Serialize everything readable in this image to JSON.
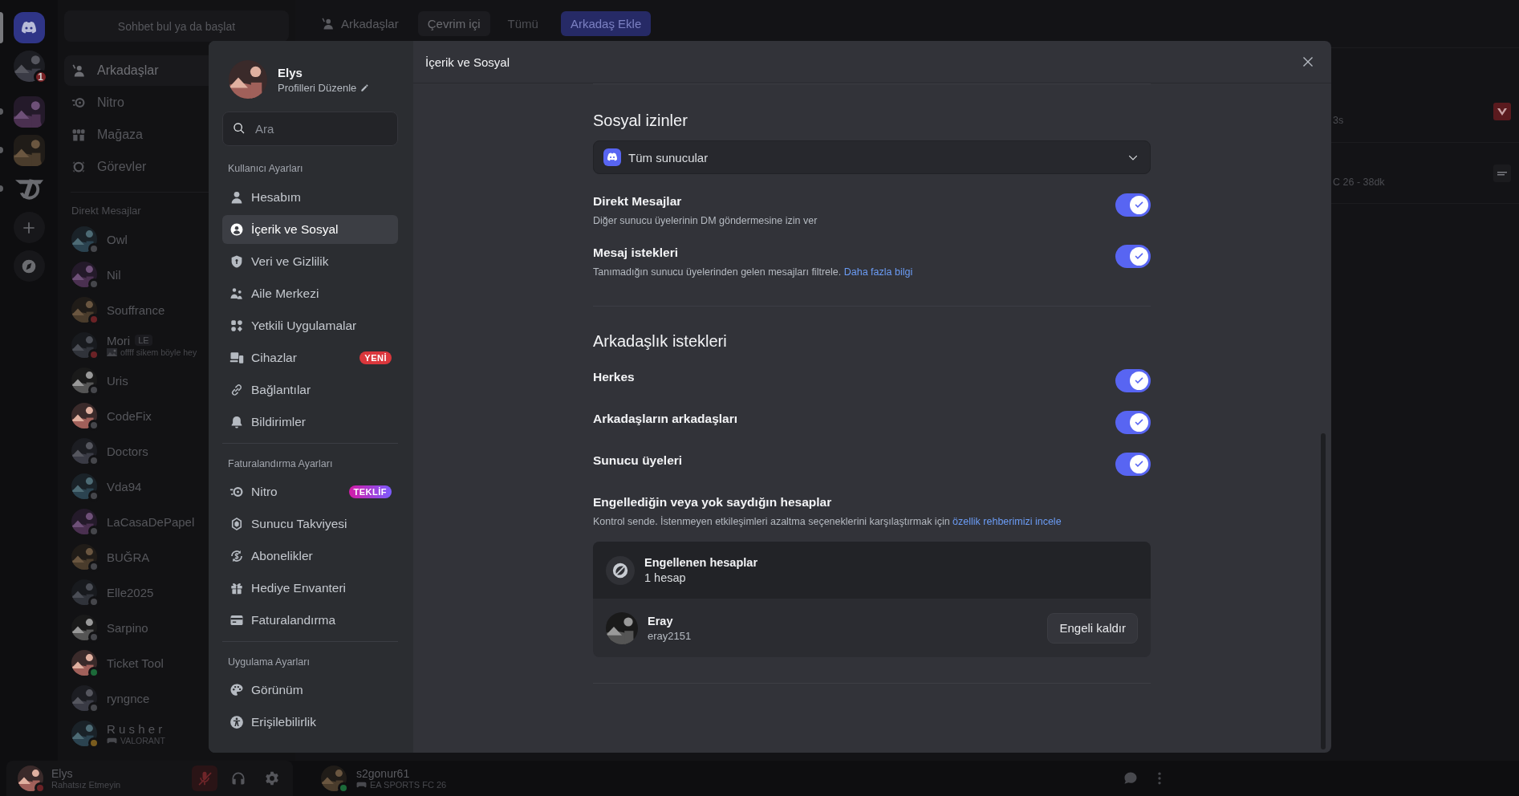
{
  "rail": {
    "items": [
      {
        "kind": "home",
        "selected": true,
        "unread": false
      },
      {
        "kind": "dm",
        "badge": "1",
        "selected": false,
        "unread": false
      },
      {
        "kind": "server",
        "selected": false,
        "unread": true
      },
      {
        "kind": "server",
        "selected": false,
        "unread": true
      },
      {
        "kind": "logo",
        "selected": false,
        "unread": true
      },
      {
        "kind": "add",
        "selected": false,
        "unread": false
      },
      {
        "kind": "discover",
        "selected": false,
        "unread": false
      }
    ]
  },
  "dm_sidebar": {
    "search": {
      "placeholder": "Sohbet bul ya da başlat"
    },
    "nav": [
      {
        "label": "Arkadaşlar",
        "kind": "friends",
        "selected": true
      },
      {
        "label": "Nitro",
        "kind": "nitro",
        "selected": false
      },
      {
        "label": "Mağaza",
        "kind": "shop",
        "selected": false
      },
      {
        "label": "Görevler",
        "kind": "quests",
        "selected": false
      }
    ],
    "heading": "Direkt Mesajlar",
    "conversations": [
      {
        "name": "Owl",
        "kind": "plain",
        "color": "#45464b"
      },
      {
        "name": "Nil",
        "kind": "plain",
        "color": "#45464b"
      },
      {
        "name": "Souffrance",
        "kind": "plain",
        "color": "#6b2226"
      },
      {
        "name": "Mori",
        "kind": "custom",
        "color": "#6b2226",
        "tag": "LE",
        "subtitle": "offff sikem böyle hey"
      },
      {
        "name": "Uris",
        "kind": "plain",
        "color": "#45464b"
      },
      {
        "name": "CodeFix",
        "kind": "plain",
        "color": "#45464b"
      },
      {
        "name": "Doctors",
        "kind": "plain",
        "color": "#45464b"
      },
      {
        "name": "Vda94",
        "kind": "plain",
        "color": "#45464b"
      },
      {
        "name": "LaCasaDePapel",
        "kind": "plain",
        "color": "#45464b"
      },
      {
        "name": "BUĞRA",
        "kind": "plain",
        "color": "#45464b"
      },
      {
        "name": "Elle2025",
        "kind": "plain",
        "color": "#45464b"
      },
      {
        "name": "Sarpino",
        "kind": "plain",
        "color": "#45464b"
      },
      {
        "name": "Ticket Tool",
        "kind": "plain",
        "color": "#1c6a39"
      },
      {
        "name": "ryngnce",
        "kind": "plain",
        "color": "#45464b"
      },
      {
        "name": "R u s h e r",
        "kind": "playing",
        "color": "#7a5c1e",
        "subtitle": "VALORANT"
      }
    ]
  },
  "friends_header": {
    "title": "Arkadaşlar",
    "tabs": [
      {
        "label": "Çevrim içi",
        "selected": true
      },
      {
        "label": "Tümü",
        "selected": false
      }
    ],
    "add_friend": "Arkadaş Ekle"
  },
  "activity_peek": [
    {
      "text": "3s"
    },
    {
      "text": "C 26 - 38dk"
    }
  ],
  "user_panel": {
    "name": "Elys",
    "status": "Rahatsız Etmeyin",
    "mic_muted": true
  },
  "now_playing": {
    "name": "s2gonur61",
    "game": "EA SPORTS FC 26"
  },
  "settings_modal": {
    "title": "İçerik ve Sosyal",
    "profile": {
      "name": "Elys",
      "edit_label": "Profilleri Düzenle"
    },
    "search": {
      "placeholder": "Ara"
    },
    "sections": [
      {
        "heading": "Kullanıcı Ayarları",
        "items": [
          {
            "label": "Hesabım",
            "kind": "account",
            "selected": false
          },
          {
            "label": "İçerik ve Sosyal",
            "kind": "content",
            "selected": true
          },
          {
            "label": "Veri ve Gizlilik",
            "kind": "privacy",
            "selected": false
          },
          {
            "label": "Aile Merkezi",
            "kind": "family",
            "selected": false
          },
          {
            "label": "Yetkili Uygulamalar",
            "kind": "apps",
            "selected": false
          },
          {
            "label": "Cihazlar",
            "kind": "devices",
            "selected": false,
            "badge": {
              "text": "YENİ",
              "kind": "new"
            }
          },
          {
            "label": "Bağlantılar",
            "kind": "link",
            "selected": false
          },
          {
            "label": "Bildirimler",
            "kind": "bell",
            "selected": false
          }
        ]
      },
      {
        "heading": "Faturalandırma Ayarları",
        "items": [
          {
            "label": "Nitro",
            "kind": "nitro",
            "selected": false,
            "badge": {
              "text": "TEKLİF",
              "kind": "offer"
            }
          },
          {
            "label": "Sunucu Takviyesi",
            "kind": "boost",
            "selected": false
          },
          {
            "label": "Abonelikler",
            "kind": "subscriptions",
            "selected": false
          },
          {
            "label": "Hediye Envanteri",
            "kind": "gift",
            "selected": false
          },
          {
            "label": "Faturalandırma",
            "kind": "card",
            "selected": false
          }
        ]
      },
      {
        "heading": "Uygulama Ayarları",
        "items": [
          {
            "label": "Görünüm",
            "kind": "palette",
            "selected": false
          },
          {
            "label": "Erişilebilirlik",
            "kind": "accessibility",
            "selected": false
          }
        ]
      }
    ],
    "social": {
      "heading": "Sosyal izinler",
      "server_select": {
        "value": "Tüm sunucular"
      },
      "settings": [
        {
          "title": "Direkt Mesajlar",
          "description": "Diğer sunucu üyelerinin DM göndermesine izin ver",
          "on": true
        },
        {
          "title": "Mesaj istekleri",
          "description": "Tanımadığın sunucu üyelerinden gelen mesajları filtrele.",
          "link": "Daha fazla bilgi",
          "on": true
        }
      ]
    },
    "friend_requests": {
      "heading": "Arkadaşlık istekleri",
      "settings": [
        {
          "title": "Herkes",
          "on": true
        },
        {
          "title": "Arkadaşların arkadaşları",
          "on": true
        },
        {
          "title": "Sunucu üyeleri",
          "on": true
        }
      ]
    },
    "blocked": {
      "heading": "Engellediğin veya yok saydığın hesaplar",
      "description": "Kontrol sende. İstenmeyen etkileşimleri azaltma seçeneklerini karşılaştırmak için",
      "link": "özellik rehberimizi incele",
      "list_title": "Engellenen hesaplar",
      "count": "1 hesap",
      "accounts": [
        {
          "name": "Eray",
          "username": "eray2151",
          "action": "Engeli kaldır"
        }
      ]
    }
  }
}
